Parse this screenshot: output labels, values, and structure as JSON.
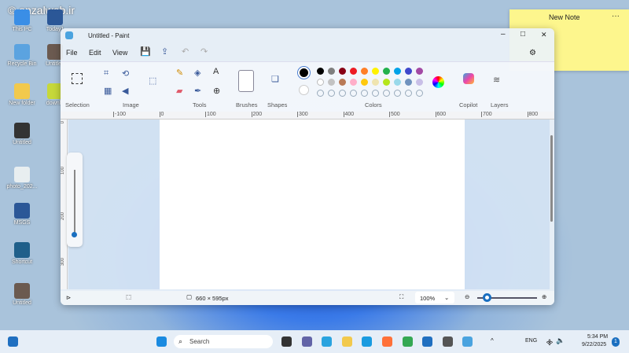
{
  "watermark": "© anzalweb.ir",
  "desktop_icons": [
    {
      "label": "This PC",
      "color": "#3a8ee6"
    },
    {
      "label": "Today1",
      "color": "#2b5797"
    },
    {
      "label": "Recycle Bin",
      "color": "#5ba3e0"
    },
    {
      "label": "Untitled",
      "color": "#6b5a50"
    },
    {
      "label": "New folder",
      "color": "#f2c94c"
    },
    {
      "label": "downlo",
      "color": "#c6d83a"
    },
    {
      "label": "Untitled",
      "color": "#333333"
    },
    {
      "label": "photo_202...",
      "color": "#e8eef0"
    },
    {
      "label": "MSGS",
      "color": "#2b5797"
    },
    {
      "label": "Shortcut",
      "color": "#1f5f8a"
    },
    {
      "label": "Untitled",
      "color": "#6b5a50"
    }
  ],
  "note": {
    "title": "New Note",
    "more": "···"
  },
  "paint": {
    "title": "Untitled - Paint",
    "window_controls": {
      "minimize": "–",
      "maximize": "□",
      "close": "✕"
    },
    "menu": [
      "File",
      "Edit",
      "View"
    ],
    "groups": [
      "Selection",
      "Image",
      "Tools",
      "Brushes",
      "Shapes",
      "Colors",
      "Copilot",
      "Layers"
    ],
    "primary_color": "#000000",
    "secondary_color": "#ffffff",
    "palette_row1": [
      "#000000",
      "#7f7f7f",
      "#880015",
      "#ed1c24",
      "#ff7f27",
      "#fff200",
      "#22b14c",
      "#00a2e8",
      "#3f48cc",
      "#a349a4"
    ],
    "palette_row2": [
      "#ffffff",
      "#c3c3c3",
      "#b97a57",
      "#ffaec9",
      "#ffc90e",
      "#efe4b0",
      "#b5e61d",
      "#99d9ea",
      "#7092be",
      "#c8bfe7"
    ],
    "ruler_h": [
      "-100",
      "0",
      "100",
      "200",
      "300",
      "400",
      "500",
      "600",
      "700",
      "800"
    ],
    "ruler_v": [
      "0",
      "100",
      "200",
      "300"
    ],
    "status": {
      "size": "660 × 595px",
      "zoom": "100%",
      "zoom_level_percent": 100
    }
  },
  "taskbar": {
    "search": "Search",
    "lang": "ENG",
    "time": "5:34 PM",
    "date": "9/22/2025",
    "badge": "1"
  }
}
